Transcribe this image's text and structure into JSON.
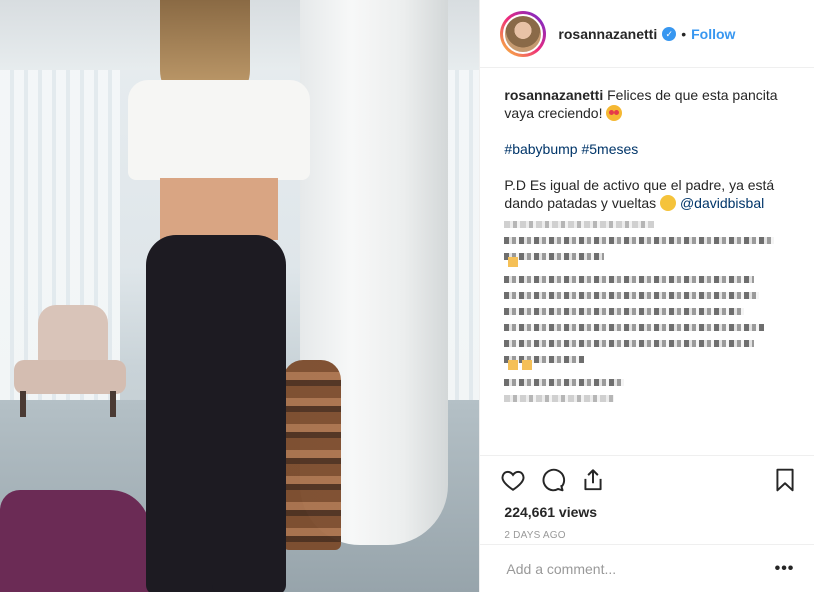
{
  "post": {
    "username": "rosannazanetti",
    "follow_label": "Follow",
    "separator": "•"
  },
  "caption": {
    "username": "rosannazanetti",
    "line1": "Felices de que esta pancita vaya creciendo!",
    "hashtags": "#babybump #5meses",
    "line2": "P.D Es igual de activo que el padre, ya está dando patadas y vueltas",
    "mention": "@davidbisbal"
  },
  "stats": {
    "views": "224,661 views",
    "date": "2 DAYS AGO"
  },
  "comment": {
    "placeholder": "Add a comment...",
    "more_label": "•••"
  },
  "icons": [
    "heart-icon",
    "comment-icon",
    "share-icon",
    "bookmark-icon",
    "verified-badge-icon"
  ],
  "colors": {
    "link": "#3897f0",
    "hashtag": "#003569",
    "muted": "#999999"
  }
}
